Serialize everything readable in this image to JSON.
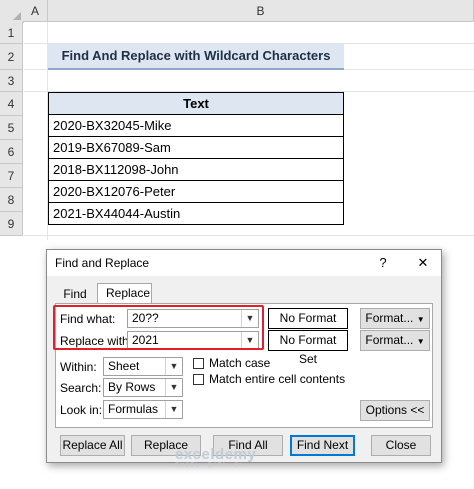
{
  "sheet": {
    "col_headers": [
      "A",
      "B"
    ],
    "row_headers": [
      "1",
      "2",
      "3",
      "4",
      "5",
      "6",
      "7",
      "8",
      "9"
    ],
    "title": "Find And Replace with Wildcard Characters",
    "table_header": "Text",
    "rows": [
      "2020-BX32045-Mike",
      "2019-BX67089-Sam",
      "2018-BX112098-John",
      "2020-BX12076-Peter",
      "2021-BX44044-Austin"
    ]
  },
  "dialog": {
    "title": "Find and Replace",
    "help_label": "?",
    "close_label": "✕",
    "tabs": [
      "Find",
      "Replace"
    ],
    "active_tab": "Replace",
    "find_label": "Find what:",
    "find_value": "20??",
    "replace_label": "Replace with:",
    "replace_value": "2021",
    "format_status_1": "No Format Set",
    "format_status_2": "No Format Set",
    "format_button_1": "Format...",
    "format_button_2": "Format...",
    "within_label": "Within:",
    "within_value": "Sheet",
    "search_label": "Search:",
    "search_value": "By Rows",
    "lookin_label": "Look in:",
    "lookin_value": "Formulas",
    "match_case_label": "Match case",
    "match_case_checked": false,
    "match_entire_label": "Match entire cell contents",
    "match_entire_checked": false,
    "options_button": "Options <<",
    "buttons": {
      "replace_all": "Replace All",
      "replace": "Replace",
      "find_all": "Find All",
      "find_next": "Find Next",
      "close": "Close"
    }
  },
  "watermark": {
    "name": "exceldemy",
    "tagline": "EXCEL · DATA · BI"
  },
  "colors": {
    "header_bg": "#e6e6e6",
    "title_fill": "#dde6f1",
    "highlight": "#e0212b",
    "focus": "#0078d7"
  }
}
